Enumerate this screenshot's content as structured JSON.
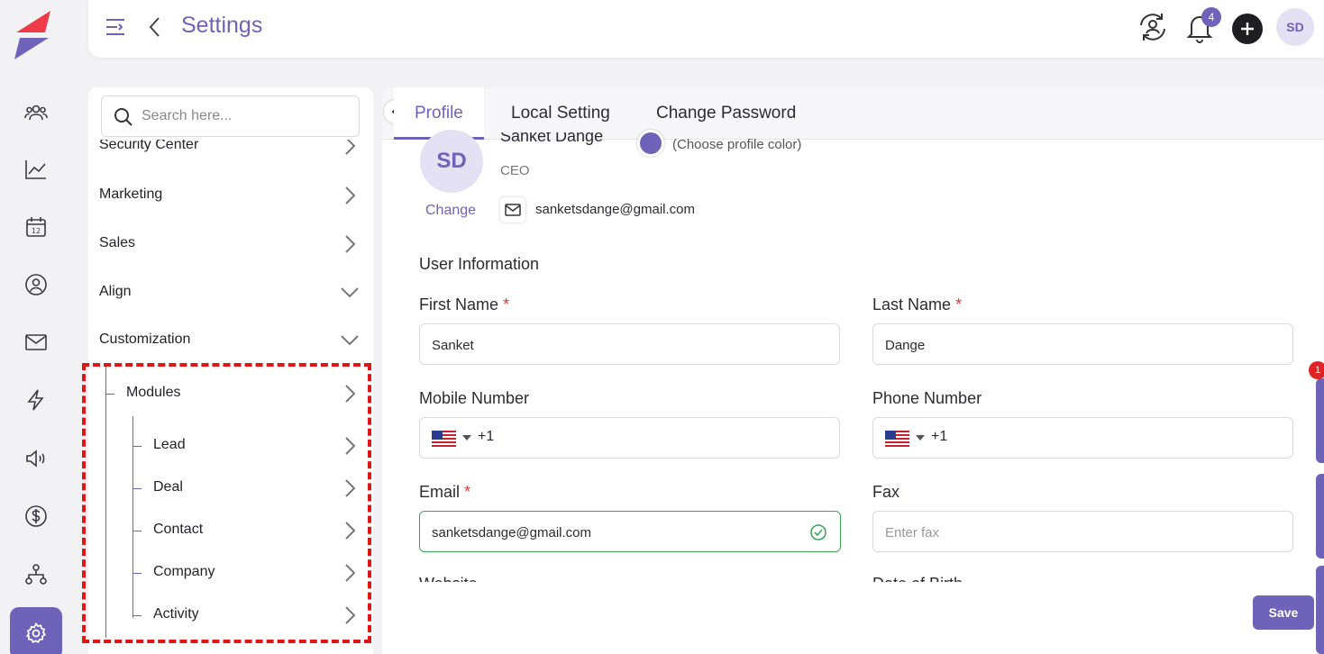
{
  "app": {
    "title": "Settings"
  },
  "header": {
    "notification_count": "4",
    "avatar_initials": "SD"
  },
  "search": {
    "placeholder": "Search here..."
  },
  "nav": {
    "items": [
      {
        "label": "Security Center",
        "state": "collapsed"
      },
      {
        "label": "Marketing",
        "state": "collapsed"
      },
      {
        "label": "Sales",
        "state": "collapsed"
      },
      {
        "label": "Align",
        "state": "expanded"
      },
      {
        "label": "Customization",
        "state": "expanded"
      }
    ],
    "modules": {
      "label": "Modules",
      "children": [
        "Lead",
        "Deal",
        "Contact",
        "Company",
        "Activity"
      ]
    }
  },
  "tabs": [
    {
      "label": "Profile",
      "active": true
    },
    {
      "label": "Local Setting",
      "active": false
    },
    {
      "label": "Change Password",
      "active": false
    }
  ],
  "profile": {
    "initials": "SD",
    "change_label": "Change",
    "name": "Sanket Dange",
    "role": "CEO",
    "color_label": "(Choose profile color)",
    "email": "sanketsdange@gmail.com",
    "accent_color": "#6e63b8"
  },
  "form": {
    "section_title": "User Information",
    "first_name": {
      "label": "First Name",
      "value": "Sanket"
    },
    "last_name": {
      "label": "Last Name",
      "value": "Dange"
    },
    "mobile": {
      "label": "Mobile Number",
      "dial_code": "+1"
    },
    "phone": {
      "label": "Phone Number",
      "dial_code": "+1"
    },
    "email": {
      "label": "Email",
      "value": "sanketsdange@gmail.com"
    },
    "fax": {
      "label": "Fax",
      "placeholder": "Enter fax"
    },
    "website": {
      "label": "Website"
    },
    "dob": {
      "label": "Date of Birth"
    },
    "required_mark": "*"
  },
  "actions": {
    "save_label": "Save"
  },
  "side_badge_count": "1"
}
